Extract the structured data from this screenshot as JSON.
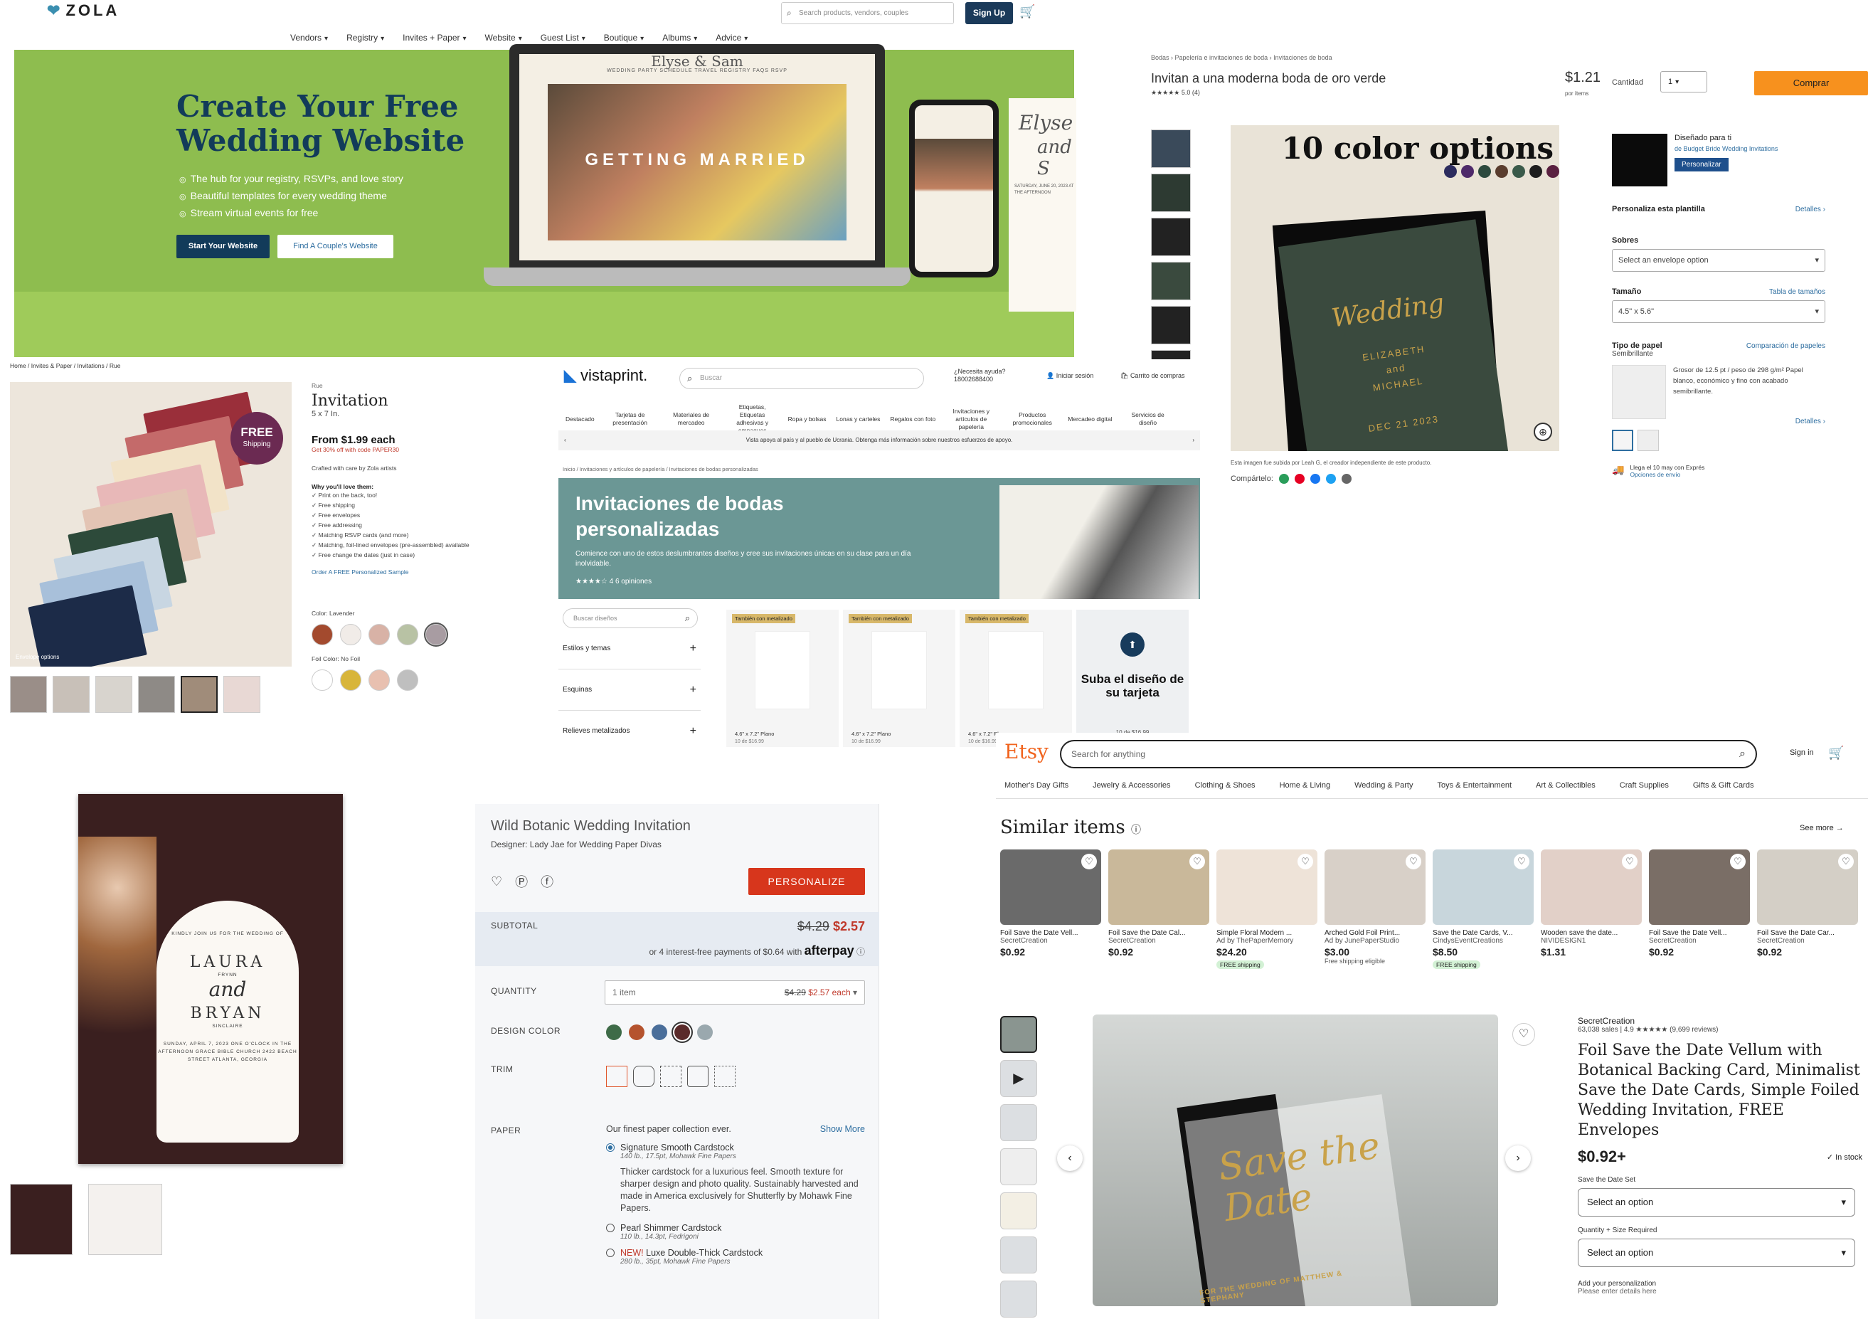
{
  "zola": {
    "logo": "ZOLA",
    "search_placeholder": "Search products, vendors, couples",
    "signup": "Sign Up",
    "nav": [
      "Vendors",
      "Registry",
      "Invites + Paper",
      "Website",
      "Guest List",
      "Boutique",
      "Albums",
      "Advice"
    ],
    "hero_title_1": "Create Your Free",
    "hero_title_2": "Wedding Website",
    "bullets": [
      "The hub for your registry, RSVPs, and love story",
      "Beautiful templates for every wedding theme",
      "Stream virtual events for free"
    ],
    "btn_start": "Start Your Website",
    "btn_find": "Find A Couple's Website",
    "laptop_name": "Elyse & Sam",
    "laptop_nav": "WEDDING PARTY   SCHEDULE   TRAVEL   REGISTRY   FAQS   RSVP",
    "laptop_overlay": "GETTING MARRIED",
    "card_script_1": "Elyse",
    "card_script_2": "and S",
    "card_text": "SATURDAY, JUNE 20, 2023 AT THE AFTERNOON"
  },
  "zazzle": {
    "breadcrumb": "Bodas   ›   Papelería e invitaciones de boda   ›   Invitaciones de boda",
    "title": "Invitan a una moderna boda de oro verde",
    "rating": "★★★★★ 5.0 (4)",
    "price": "$1.21",
    "per": "por ítems",
    "qty_label": "Cantidad",
    "qty_value": "1",
    "buy": "Comprar",
    "main_headline": "10 color options",
    "inv_word": "Wedding",
    "inv_names": "ELIZABETH\nand\nMICHAEL",
    "inv_date": "DEC  21  2023",
    "swatches": [
      "#2c2c5e",
      "#4e2a6a",
      "#2d4a3e",
      "#5a3d2e",
      "#3a5a4a",
      "#1e1e1e",
      "#5a2040",
      "#6e1e3c",
      "#7a2a5a",
      "#4a1a3a"
    ],
    "caption": "Esta imagen fue subida por Leah G, el creador independiente de este producto.",
    "share_label": "Compártelo:",
    "designed_for": "Diseñado para ti",
    "designed_by": "de Budget Bride Wedding Invitations",
    "personalize_btn": "Personalizar",
    "customize": "Personaliza esta plantilla",
    "details": "Detalles ›",
    "envelopes_label": "Sobres",
    "envelopes_value": "Select an envelope option",
    "size_label": "Tamaño",
    "size_link": "Tabla de tamaños",
    "size_value": "4.5\" x 5.6\"",
    "paper_label": "Tipo de papel",
    "paper_link": "Comparación de papeles",
    "paper_value": "Semibrillante",
    "paper_desc": "Grosor de 12.5 pt / peso de 298 g/m² Papel blanco, económico y fino con acabado semibrillante.",
    "details2": "Detalles ›",
    "ship1": "Llega el 10 may con Exprés",
    "ship2": "Opciones de envío"
  },
  "left2": {
    "breadcrumb": "Home   /   Invites & Paper   /   Invitations   /   Rue",
    "free_badge": "FREE",
    "free_badge_2": "Shipping",
    "img_caption": "Envelope options",
    "brand": "Rue",
    "title": "Invitation",
    "size": "5 x 7 In.",
    "price": "From $1.99 each",
    "promo": "Get 30% off with code PAPER30",
    "crafted": "Crafted with care by Zola artists",
    "why": "Why you'll love them:",
    "list": [
      "Print on the back, too!",
      "Free shipping",
      "Free envelopes",
      "Free addressing",
      "Matching RSVP cards (and more)",
      "Matching, foil-lined envelopes (pre-assembled) available",
      "Free change the dates (just in case)"
    ],
    "sample": "Order A FREE Personalized Sample",
    "color_label": "Color: Lavender",
    "colors": [
      "#a34a2e",
      "#f1ece8",
      "#d8b2a6",
      "#b8c2a4",
      "#a89ca2"
    ],
    "foil_label": "Foil Color: No Foil",
    "foils": [
      "#ffffff",
      "#d8b53a",
      "#e8c0b0",
      "#bfbfbf"
    ]
  },
  "vista": {
    "logo": "vistaprint.",
    "search_placeholder": "Buscar",
    "help": "¿Necesita ayuda? 18002688400",
    "login": "Iniciar sesión",
    "cart": "Carrito de compras",
    "nav": [
      "Destacado",
      "Tarjetas de presentación",
      "Materiales de mercadeo",
      "Etiquetas, Etiquetas adhesivas y empaques",
      "Ropa y bolsas",
      "Lonas y carteles",
      "Regalos con foto",
      "Invitaciones y artículos de papelería",
      "Productos promocionales",
      "Mercadeo digital",
      "Servicios de diseño"
    ],
    "banner": "Vista apoya al país y al pueblo de Ucrania. Obtenga más información sobre nuestros esfuerzos de apoyo.",
    "breadcrumb": "Inicio  /  Invitaciones y artículos de papelería  /  Invitaciones de bodas personalizadas",
    "hero_title": "Invitaciones de bodas personalizadas",
    "hero_desc": "Comience con uno de estos deslumbrantes diseños y cree sus invitaciones únicas en su clase para un día inolvidable.",
    "hero_rating": "★★★★☆ 4   6 opiniones",
    "filter_search": "Buscar diseños",
    "filters": [
      "Estilos y temas",
      "Esquinas",
      "Relieves metalizados"
    ],
    "cards": [
      {
        "tag": "También con metalizado",
        "size": "4.6\" x 7.2\" Plano",
        "price": "10 de $16.99"
      },
      {
        "tag": "También con metalizado",
        "size": "4.6\" x 7.2\" Plano",
        "price": "10 de $16.99"
      },
      {
        "tag": "También con metalizado",
        "size": "4.6\" x 7.2\" Plano",
        "price": "10 de $16.99"
      }
    ],
    "upload_title": "Suba el diseño de su tarjeta",
    "upload_price": "10 de $16.99"
  },
  "shutterfly": {
    "inv_line1": "KINDLY JOIN US FOR THE WEDDING OF",
    "name1": "LAURA",
    "name1_sub": "FRYNN",
    "amp": "and",
    "name2": "BRYAN",
    "name2_sub": "SINCLAIRE",
    "details": "SUNDAY, APRIL 7, 2023 ONE O'CLOCK IN THE AFTERNOON GRACE BIBLE CHURCH 2422 BEACH STREET ATLANTA, GEORGIA",
    "title": "Wild Botanic Wedding Invitation",
    "designer": "Designer: Lady Jae for Wedding Paper Divas",
    "personalize": "PERSONALIZE",
    "subtotal_label": "SUBTOTAL",
    "old_price": "$4.29",
    "new_price": "$2.57",
    "afterpay": "or 4 interest-free payments of $0.64 with",
    "afterpay_brand": "afterpay",
    "qty_label": "QUANTITY",
    "qty_value": "1 item",
    "qty_old": "$4.29",
    "qty_new": "$2.57 each",
    "design_color_label": "DESIGN COLOR",
    "design_colors": [
      "#3e6b48",
      "#b5532e",
      "#4a6e9a",
      "#5a2a2a",
      "#9aa8ae"
    ],
    "trim_label": "TRIM",
    "paper_label": "PAPER",
    "paper_intro": "Our finest paper collection ever.",
    "show_more": "Show More",
    "p1": "Signature Smooth Cardstock",
    "p1_spec": "140 lb., 17.5pt, Mohawk Fine Papers",
    "p1_desc": "Thicker cardstock for a luxurious feel. Smooth texture for sharper design and photo quality. Sustainably harvested and made in America exclusively for Shutterfly by Mohawk Fine Papers.",
    "p2": "Pearl Shimmer Cardstock",
    "p2_spec": "110 lb., 14.3pt, Fedrigoni",
    "p3_new": "NEW!",
    "p3": "Luxe Double-Thick Cardstock",
    "p3_spec": "280 lb., 35pt, Mohawk Fine Papers"
  },
  "etsy": {
    "logo": "Etsy",
    "search_placeholder": "Search for anything",
    "signin": "Sign in",
    "nav": [
      "Mother's Day Gifts",
      "Jewelry & Accessories",
      "Clothing & Shoes",
      "Home & Living",
      "Wedding & Party",
      "Toys & Entertainment",
      "Art & Collectibles",
      "Craft Supplies",
      "Gifts & Gift Cards"
    ],
    "similar": "Similar items",
    "see_more": "See more  →",
    "items": [
      {
        "title": "Foil Save the Date Vell...",
        "seller": "SecretCreation",
        "price": "$0.92",
        "extra": "",
        "color": "#6a6a6a"
      },
      {
        "title": "Foil Save the Date Cal...",
        "seller": "SecretCreation",
        "price": "$0.92",
        "extra": "",
        "color": "#c9b89a"
      },
      {
        "title": "Simple Floral Modern ...",
        "seller": "Ad by ThePaperMemory",
        "price": "$24.20",
        "extra": "FREE shipping",
        "color": "#eee3d8"
      },
      {
        "title": "Arched Gold Foil Print...",
        "seller": "Ad by JunePaperStudio",
        "price": "$3.00",
        "extra": "Free shipping eligible",
        "color": "#d8d0c8"
      },
      {
        "title": "Save the Date Cards, V...",
        "seller": "CindysEventCreations",
        "price": "$8.50",
        "extra": "FREE shipping",
        "color": "#c8d6dc"
      },
      {
        "title": "Wooden save the date...",
        "seller": "NIVIDESIGN1",
        "price": "$1.31",
        "extra": "",
        "color": "#e2d0c8"
      },
      {
        "title": "Foil Save the Date Vell...",
        "seller": "SecretCreation",
        "price": "$0.92",
        "extra": "",
        "color": "#7a6e66"
      },
      {
        "title": "Foil Save the Date Car...",
        "seller": "SecretCreation",
        "price": "$0.92",
        "extra": "",
        "color": "#d4cfc6"
      }
    ],
    "main_text": "Save the Date",
    "main_names": "FOR THE WEDDING OF MATTHEW & STEPHANY",
    "shop": "SecretCreation",
    "sales": "63,038 sales  |  4.9 ★★★★★ (9,699 reviews)",
    "title": "Foil Save the Date Vellum with Botanical Backing Card, Minimalist Save the Date Cards, Simple Foiled Wedding Invitation, FREE Envelopes",
    "price": "$0.92+",
    "stock": "✓ In stock",
    "opt1_label": "Save the Date Set",
    "opt1_value": "Select an option",
    "opt2_label": "Quantity + Size Required",
    "opt2_value": "Select an option",
    "personalize": "Add your personalization",
    "personalize_sub": "Please enter details here"
  }
}
